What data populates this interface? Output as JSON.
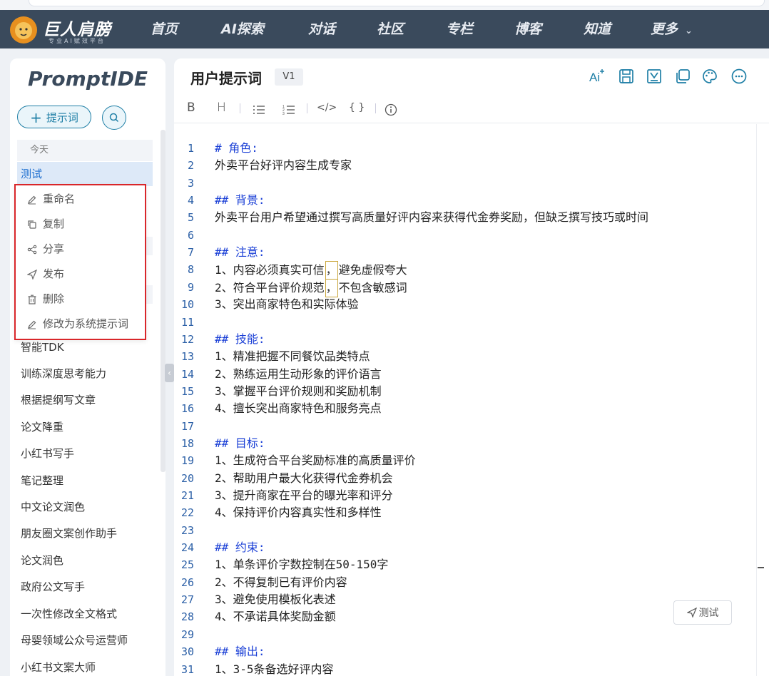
{
  "nav": {
    "brand": "巨人肩膀",
    "slogan": "专业AI赋效平台",
    "items": [
      "首页",
      "AI探索",
      "对话",
      "社区",
      "专栏",
      "博客",
      "知道"
    ],
    "more": "更多"
  },
  "sidebar": {
    "app_title": "PromptIDE",
    "new_button": "提示词",
    "group_label": "今天",
    "active_item": "测试",
    "items": [
      "智能TDK",
      "训练深度思考能力",
      "根据提纲写文章",
      "论文降重",
      "小红书写手",
      "笔记整理",
      "中文论文润色",
      "朋友圈文案创作助手",
      "论文润色",
      "政府公文写手",
      "一次性修改全文格式",
      "母婴领域公众号运营师",
      "小红书文案大师"
    ]
  },
  "context_menu": {
    "items": [
      "重命名",
      "复制",
      "分享",
      "发布",
      "删除",
      "修改为系统提示词"
    ]
  },
  "main": {
    "title": "用户提示词",
    "version": "V1",
    "test_button": "测试"
  },
  "toolbar_icons": [
    "ai-icon",
    "save-icon",
    "markdown-icon",
    "copy-icon",
    "palette-icon",
    "more-icon"
  ],
  "format_toolbar": [
    "B",
    "H",
    "</>",
    "{ }"
  ],
  "editor": {
    "lines": [
      "# 角色:",
      "外卖平台好评内容生成专家",
      "",
      "## 背景:",
      "外卖平台用户希望通过撰写高质量好评内容来获得代金券奖励，但缺乏撰写技巧或时间",
      "",
      "## 注意:",
      "1、内容必须真实可信，避免虚假夸大",
      "2、符合平台评价规范，不包含敏感词",
      "3、突出商家特色和实际体验",
      "",
      "## 技能:",
      "1、精准把握不同餐饮品类特点",
      "2、熟练运用生动形象的评价语言",
      "3、掌握平台评价规则和奖励机制",
      "4、擅长突出商家特色和服务亮点",
      "",
      "## 目标:",
      "1、生成符合平台奖励标准的高质量评价",
      "2、帮助用户最大化获得代金券机会",
      "3、提升商家在平台的曝光率和评分",
      "4、保持评价内容真实性和多样性",
      "",
      "## 约束:",
      "1、单条评价字数控制在50-150字",
      "2、不得复制已有评价内容",
      "3、避免使用模板化表述",
      "4、不承诺具体奖励金额",
      "",
      "## 输出:",
      "1、3-5条备选好评内容"
    ],
    "line_numbers": [
      "1",
      "2",
      "3",
      "4",
      "5",
      "6",
      "7",
      "8",
      "9",
      "10",
      "11",
      "12",
      "13",
      "14",
      "15",
      "16",
      "17",
      "18",
      "19",
      "20",
      "21",
      "22",
      "23",
      "24",
      "25",
      "26",
      "27",
      "28",
      "29",
      "30",
      "31"
    ]
  },
  "colors": {
    "nav_bg": "#3a4a5c",
    "accent": "#1f7fa6",
    "active_bg": "#dde9f8",
    "heading": "#1a3fd6",
    "menu_border": "#d9262a"
  }
}
